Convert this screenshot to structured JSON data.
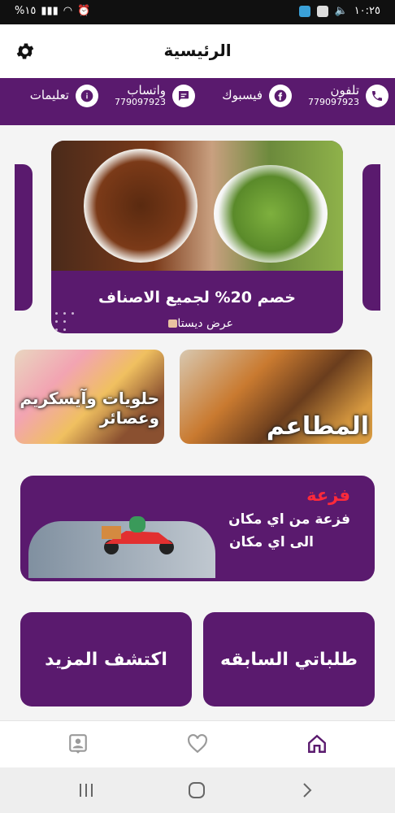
{
  "status_bar": {
    "time": "١٠:٢٥",
    "battery": "%١٥",
    "colors": {
      "bg": "#101010"
    }
  },
  "header": {
    "title": "الرئيسية",
    "settings_icon": "gear-icon"
  },
  "contacts": [
    {
      "label": "تلفون",
      "number": "779097923",
      "icon": "phone-icon"
    },
    {
      "label": "فيسبوك",
      "number": "",
      "icon": "facebook-icon"
    },
    {
      "label": "واتساب",
      "number": "779097923",
      "icon": "chat-icon"
    },
    {
      "label": "تعليمات",
      "number": "",
      "icon": "info-icon"
    }
  ],
  "slider": {
    "title": "خصم 20% لجميع الاصناف",
    "subtitle": "عرض ديستا"
  },
  "categories": [
    {
      "label": "المطاعم"
    },
    {
      "label": "حلويات وآيسكريم وعصائر"
    }
  ],
  "banner": {
    "title": "فزعة",
    "line1": "فزعة من اي مكان",
    "line2": "الى اي مكان"
  },
  "tiles": {
    "previous_orders": "طلباتي السابقه",
    "discover_more": "اكتشف المزيد"
  },
  "bottom_nav": [
    {
      "icon": "home-icon",
      "active": true
    },
    {
      "icon": "heart-icon",
      "active": false
    },
    {
      "icon": "profile-icon",
      "active": false
    }
  ],
  "colors": {
    "primary": "#5a1a6e",
    "accent_red": "#ff2a3a",
    "nav_active": "#5a1a6e",
    "nav_inactive": "#9a9a9a"
  }
}
